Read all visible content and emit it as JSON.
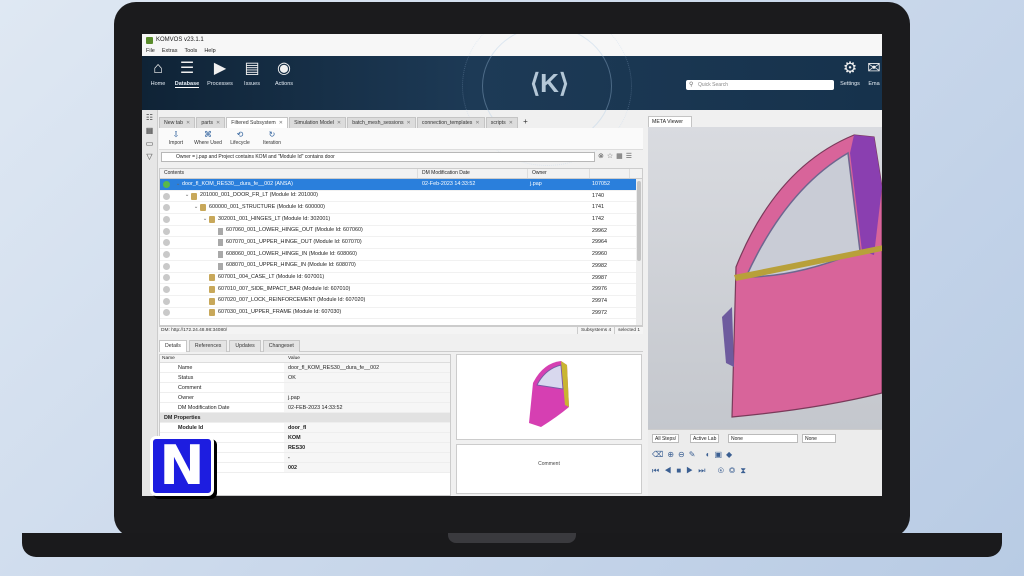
{
  "window": {
    "title": "KOMVOS v23.1.1"
  },
  "menu": [
    "File",
    "Extras",
    "Tools",
    "Help"
  ],
  "ribbon": {
    "buttons": [
      {
        "label": "Home",
        "icon": "home-icon"
      },
      {
        "label": "Database",
        "icon": "database-icon",
        "active": true
      },
      {
        "label": "Processes",
        "icon": "processes-icon"
      },
      {
        "label": "Issues",
        "icon": "issues-icon"
      },
      {
        "label": "Actions",
        "icon": "actions-icon"
      }
    ],
    "search_placeholder": "Quick Search",
    "settings_label": "Settings",
    "email_label": "Ema"
  },
  "tabs": [
    "New tab",
    "parts",
    "Filtered Subsystem",
    "Simulation Model",
    "batch_mesh_sessions",
    "connection_templates",
    "scripts"
  ],
  "toolbar": {
    "import": "Import",
    "where_used": "Where Used",
    "lifecycle": "Lifecycle",
    "iteration": "Iteration"
  },
  "filter": {
    "text": "Owner = j.pap and Project contains KOM and \"Module Id\" contains door"
  },
  "grid": {
    "headers": [
      "Contents",
      "DM Modification Date",
      "Owner",
      ""
    ],
    "rows": [
      {
        "name": "door_fl_KOM_RES30__dura_fe__002 (ANSA)",
        "date": "02-Feb-2023 14:33:52",
        "owner": "j.pap",
        "id": "107052"
      },
      {
        "name": "201000_001_DOOR_FR_LT (Module Id: 201000)",
        "date": "",
        "owner": "",
        "id": "1740"
      },
      {
        "name": "600000_001_STRUCTURE (Module Id: 600000)",
        "date": "",
        "owner": "",
        "id": "1741"
      },
      {
        "name": "302001_001_HINGES_LT (Module Id: 302001)",
        "date": "",
        "owner": "",
        "id": "1742"
      },
      {
        "name": "607060_001_LOWER_HINGE_OUT (Module Id: 607060)",
        "date": "",
        "owner": "",
        "id": "29962"
      },
      {
        "name": "607070_001_UPPER_HINGE_OUT (Module Id: 607070)",
        "date": "",
        "owner": "",
        "id": "29964"
      },
      {
        "name": "608060_001_LOWER_HINGE_IN (Module Id: 608060)",
        "date": "",
        "owner": "",
        "id": "29960"
      },
      {
        "name": "608070_001_UPPER_HINGE_IN (Module Id: 608070)",
        "date": "",
        "owner": "",
        "id": "29982"
      },
      {
        "name": "607001_004_CASE_LT (Module Id: 607001)",
        "date": "",
        "owner": "",
        "id": "29987"
      },
      {
        "name": "607010_007_SIDE_IMPACT_BAR (Module Id: 607010)",
        "date": "",
        "owner": "",
        "id": "29976"
      },
      {
        "name": "607020_007_LOCK_REINFORCEMENT (Module Id: 607020)",
        "date": "",
        "owner": "",
        "id": "29974"
      },
      {
        "name": "607030_001_UPPER_FRAME (Module Id: 607030)",
        "date": "",
        "owner": "",
        "id": "29972"
      }
    ]
  },
  "status": {
    "dm": "DM: http://172.24.48.98:34080/",
    "subsystems": "Subsystems 4",
    "selected": "selected 1"
  },
  "details": {
    "tabs": [
      "Details",
      "References",
      "Updates",
      "Changeset"
    ],
    "headers": [
      "Name",
      "Value"
    ],
    "rows": [
      {
        "k": "Name",
        "v": "door_fl_KOM_RES30__dura_fe__002"
      },
      {
        "k": "Status",
        "v": "OK"
      },
      {
        "k": "Comment",
        "v": ""
      },
      {
        "k": "Owner",
        "v": "j.pap"
      },
      {
        "k": "DM Modification Date",
        "v": "02-FEB-2023 14:33:52"
      }
    ],
    "section": "DM Properties",
    "dm_rows": [
      {
        "k": "Module Id",
        "v": "door_fl"
      },
      {
        "k": "",
        "v": "KOM"
      },
      {
        "k": "",
        "v": "RES30"
      },
      {
        "k": "",
        "v": "-"
      },
      {
        "k": "",
        "v": "002"
      }
    ],
    "comment_label": "Comment"
  },
  "viewer": {
    "tab": "META Viewer",
    "steps": "All Steps/",
    "active": "Active Lab",
    "none1": "None",
    "none2": "None"
  },
  "logo_letter": "N"
}
